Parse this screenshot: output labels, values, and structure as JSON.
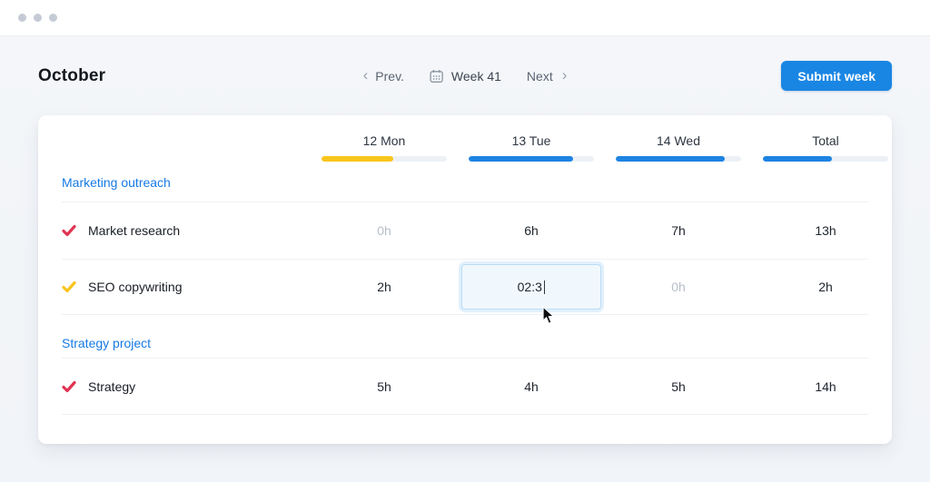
{
  "window": {
    "controls": "dots"
  },
  "header": {
    "title": "October",
    "nav": {
      "prev_label": "Prev.",
      "week_label": "Week 41",
      "next_label": "Next"
    },
    "submit_label": "Submit week"
  },
  "colors": {
    "accent_blue": "#1a86e3",
    "link_blue": "#177ae4",
    "bar_yellow": "#f8c51c",
    "bar_blue": "#1d83e2",
    "check_red": "#e13352",
    "check_yellow": "#f8c51c"
  },
  "timesheet": {
    "columns": [
      {
        "label": "12 Mon",
        "fill_pct": 57,
        "fill_color": "#f8c51c"
      },
      {
        "label": "13 Tue",
        "fill_pct": 83,
        "fill_color": "#1d83e2"
      },
      {
        "label": "14 Wed",
        "fill_pct": 87,
        "fill_color": "#1d83e2"
      },
      {
        "label": "Total",
        "fill_pct": 55,
        "fill_color": "#1d83e2"
      }
    ],
    "sections": [
      {
        "title": "Marketing outreach",
        "rows": [
          {
            "name": "Market research",
            "check_color": "#e13352",
            "cells": [
              {
                "text": "0h",
                "muted": true
              },
              {
                "text": "6h",
                "muted": false
              },
              {
                "text": "7h",
                "muted": false
              },
              {
                "text": "13h",
                "muted": false
              }
            ]
          },
          {
            "name": "SEO copywriting",
            "check_color": "#f8c51c",
            "cells": [
              {
                "text": "2h",
                "muted": false
              },
              {
                "input": true,
                "value": "02:3"
              },
              {
                "text": "0h",
                "muted": true
              },
              {
                "text": "2h",
                "muted": false
              }
            ]
          }
        ]
      },
      {
        "title": "Strategy project",
        "rows": [
          {
            "name": "Strategy",
            "check_color": "#e13352",
            "cells": [
              {
                "text": "5h",
                "muted": false
              },
              {
                "text": "4h",
                "muted": false
              },
              {
                "text": "5h",
                "muted": false
              },
              {
                "text": "14h",
                "muted": false
              }
            ]
          }
        ]
      }
    ]
  }
}
